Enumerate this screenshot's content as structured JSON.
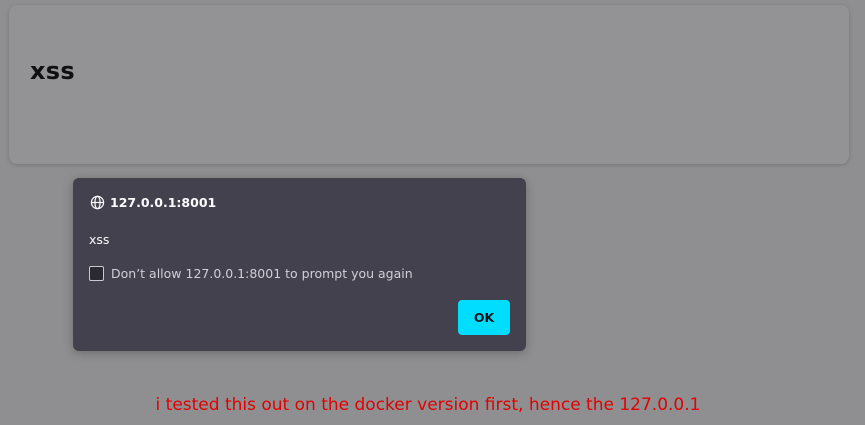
{
  "page": {
    "title": "xss"
  },
  "dialog": {
    "origin": "127.0.0.1:8001",
    "origin_icon": "globe-icon",
    "message": "xss",
    "checkbox_label": "Don’t allow 127.0.0.1:8001 to prompt you again",
    "checkbox_checked": false,
    "ok_label": "OK"
  },
  "annotation": {
    "text": "i tested this out on the docker version first, hence the 127.0.0.1"
  },
  "colors": {
    "overlay_background": "#8f8f91",
    "dialog_background": "#42414d",
    "ok_button": "#00ddff",
    "annotation_text": "#e20000"
  }
}
